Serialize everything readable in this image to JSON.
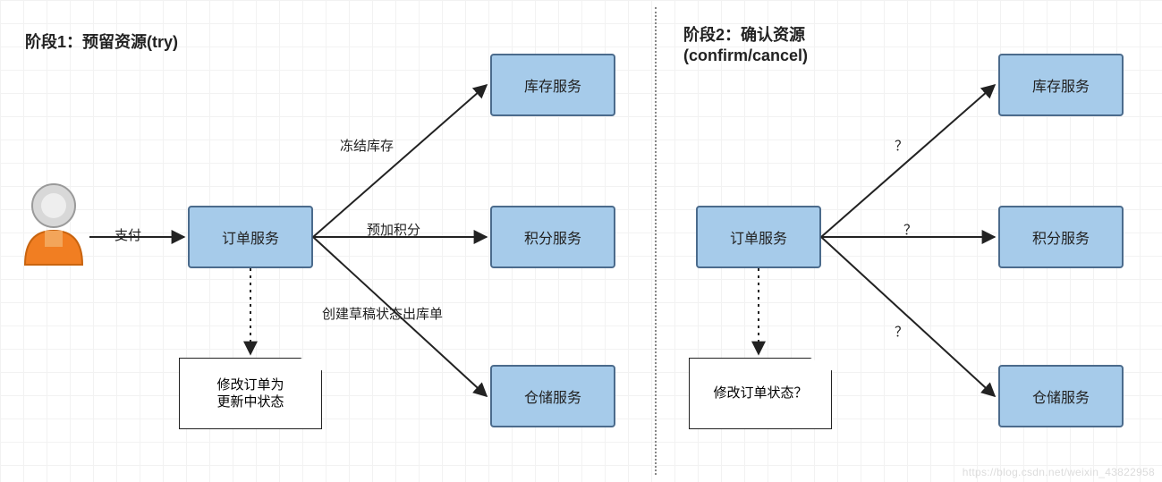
{
  "phase1": {
    "title": "阶段1：预留资源(try)",
    "edge_pay": "支付",
    "order_service": "订单服务",
    "edge_freeze": "冻结库存",
    "edge_points": "预加积分",
    "edge_draft": "创建草稿状态出库单",
    "inventory_service": "库存服务",
    "points_service": "积分服务",
    "warehouse_service": "仓储服务",
    "note": "修改订单为\n更新中状态"
  },
  "phase2": {
    "title": "阶段2：确认资源\n(confirm/cancel)",
    "order_service": "订单服务",
    "q1": "？",
    "q2": "？",
    "q3": "？",
    "inventory_service": "库存服务",
    "points_service": "积分服务",
    "warehouse_service": "仓储服务",
    "note": "修改订单状态？"
  },
  "watermark": "https://blog.csdn.net/weixin_43822958"
}
